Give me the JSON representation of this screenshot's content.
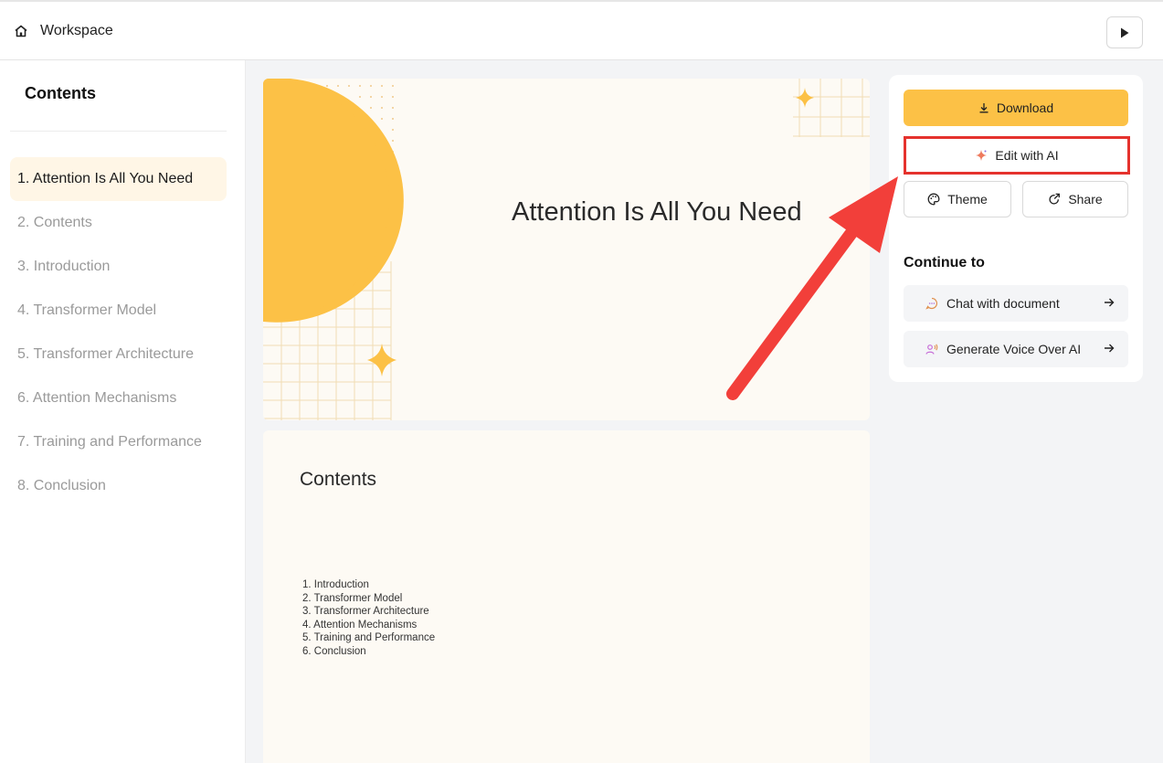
{
  "header": {
    "title": "Workspace",
    "home_icon": "home-icon",
    "play_icon": "play-icon"
  },
  "sidebar": {
    "title": "Contents",
    "items": [
      {
        "label": "1. Attention Is All You Need",
        "active": true
      },
      {
        "label": "2. Contents",
        "active": false
      },
      {
        "label": "3. Introduction",
        "active": false
      },
      {
        "label": "4. Transformer Model",
        "active": false
      },
      {
        "label": "5. Transformer Architecture",
        "active": false
      },
      {
        "label": "6. Attention Mechanisms",
        "active": false
      },
      {
        "label": "7. Training and Performance",
        "active": false
      },
      {
        "label": "8. Conclusion",
        "active": false
      }
    ]
  },
  "slides": [
    {
      "title": "Attention Is All You Need"
    },
    {
      "title": "Contents",
      "items": [
        "1. Introduction",
        "2. Transformer Model",
        "3. Transformer Architecture",
        "4. Attention Mechanisms",
        "5. Training and Performance",
        "6. Conclusion"
      ]
    }
  ],
  "panel": {
    "download_label": "Download",
    "edit_ai_label": "Edit with AI",
    "theme_label": "Theme",
    "share_label": "Share",
    "continue_title": "Continue to",
    "continue_items": [
      {
        "label": "Chat with document",
        "icon": "chat-icon"
      },
      {
        "label": "Generate Voice Over AI",
        "icon": "voice-icon"
      }
    ]
  },
  "colors": {
    "accent_yellow": "#fcc146",
    "highlight_red": "#e5322d",
    "active_bg": "#fff6e6",
    "slide_bg": "#fdfaf4"
  }
}
